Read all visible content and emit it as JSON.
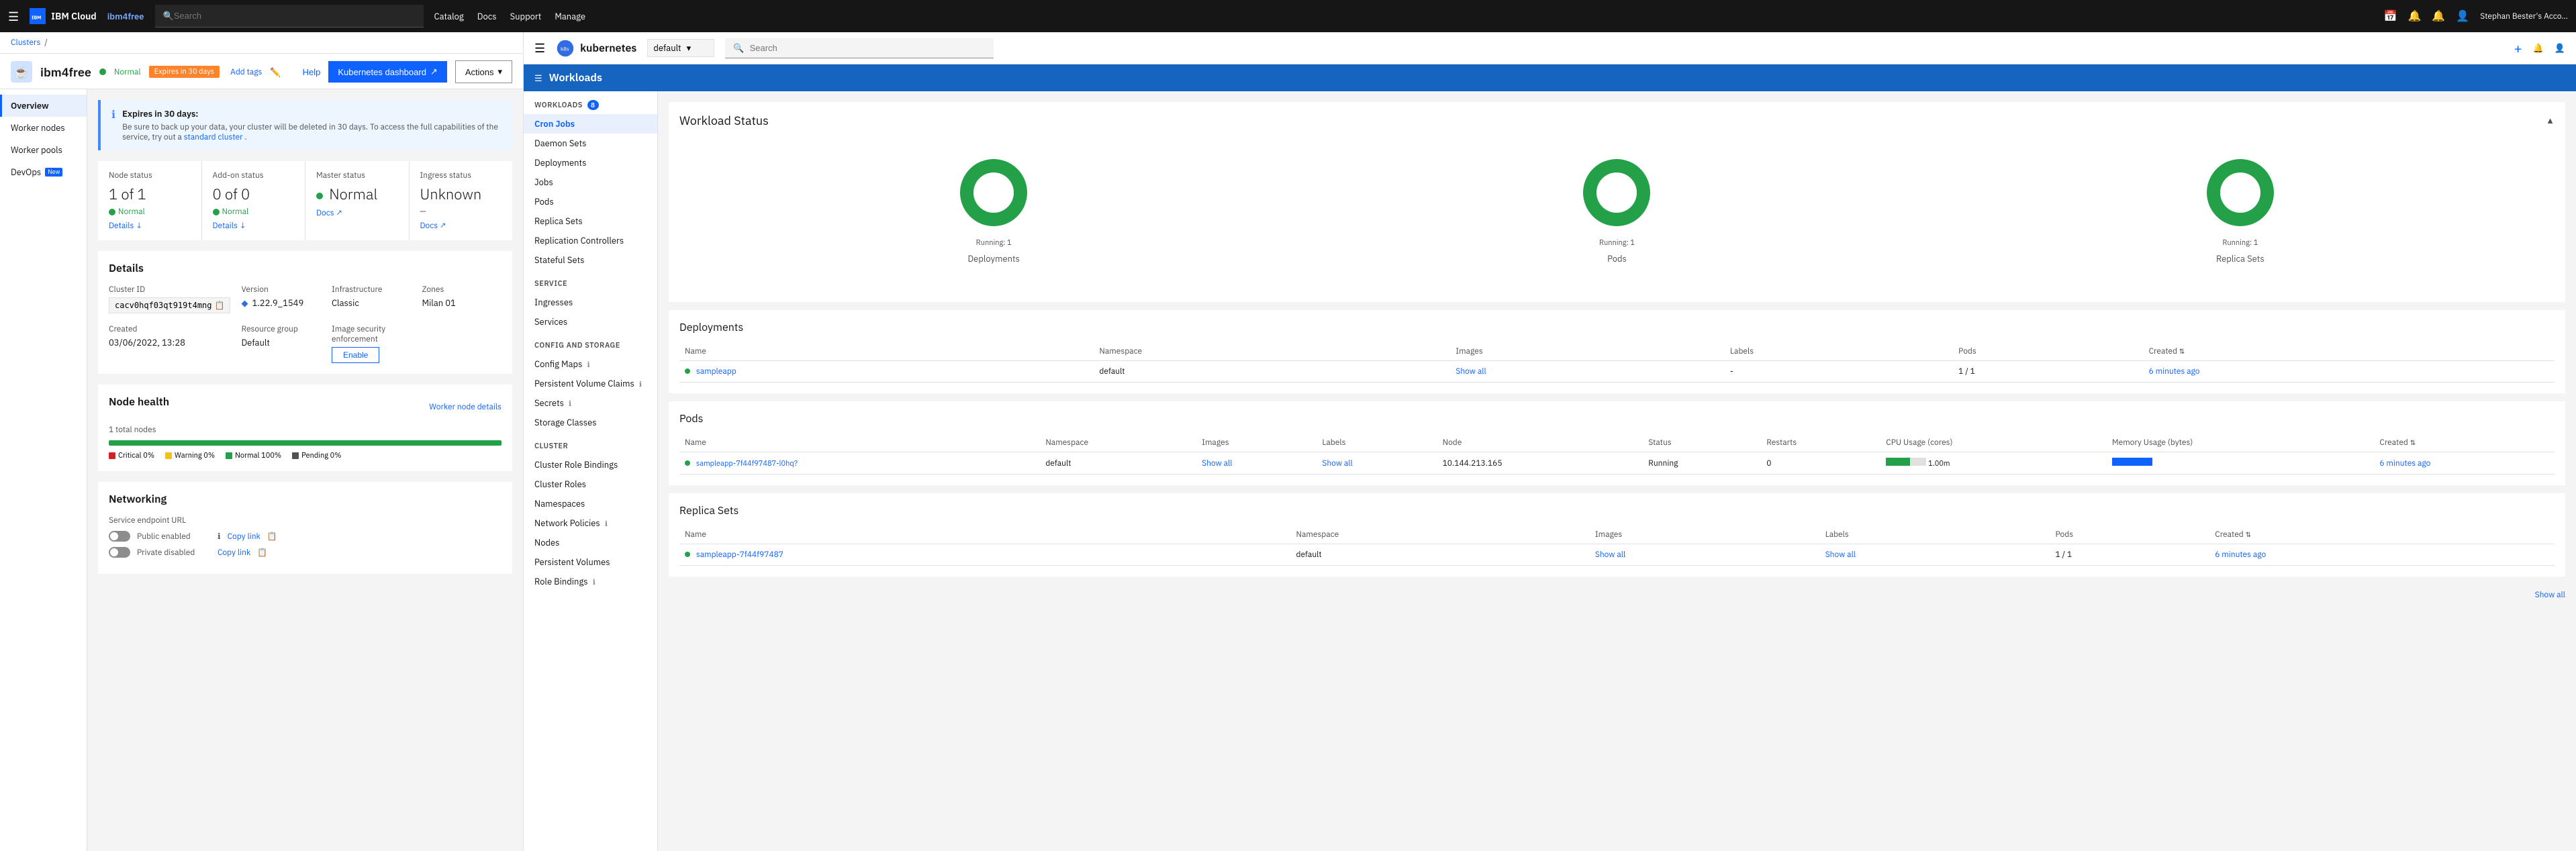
{
  "topnav": {
    "brand": "IBM Cloud",
    "appname": "ibm4free",
    "search_placeholder": "Search",
    "links": [
      "Catalog",
      "Docs",
      "Support"
    ],
    "manage": "Manage",
    "user": "Stephan Bester's Acco..."
  },
  "breadcrumb": {
    "parent": "Clusters",
    "current": "ibm4free"
  },
  "cluster": {
    "name": "ibm4free",
    "status": "Normal",
    "expires_badge": "Expires in 30 days",
    "add_tags": "Add tags",
    "help": "Help",
    "k8s_dashboard": "Kubernetes dashboard",
    "actions": "Actions"
  },
  "leftnav": {
    "items": [
      {
        "label": "Overview",
        "active": true
      },
      {
        "label": "Worker nodes",
        "active": false
      },
      {
        "label": "Worker pools",
        "active": false
      },
      {
        "label": "DevOps",
        "active": false,
        "badge": "New"
      }
    ]
  },
  "alert": {
    "title": "Expires in 30 days:",
    "body": "Be sure to back up your data, your cluster will be deleted in 30 days. To access the full capabilities of the service, try out a",
    "link_text": "standard cluster",
    "body_end": "."
  },
  "status_cards": [
    {
      "label": "Node status",
      "value": "1 of 1",
      "sub": "Normal",
      "link": "Details ↓"
    },
    {
      "label": "Add-on status",
      "value": "0 of 0",
      "sub": "Normal",
      "link": "Details ↓"
    },
    {
      "label": "Master status",
      "value": "Normal",
      "sub": "",
      "link": "Docs ↗"
    },
    {
      "label": "Ingress status",
      "value": "Unknown",
      "sub": "—",
      "link": "Docs ↗"
    }
  ],
  "details": {
    "title": "Details",
    "cluster_id_label": "Cluster ID",
    "cluster_id": "cacv0hqf03qt919t4mng",
    "version_label": "Version",
    "version": "1.22.9_1549",
    "infrastructure_label": "Infrastructure",
    "infrastructure": "Classic",
    "zones_label": "Zones",
    "zones": "Milan 01",
    "created_label": "Created",
    "created": "03/06/2022, 13:28",
    "resource_group_label": "Resource group",
    "resource_group": "Default",
    "image_security_label": "Image security enforcement",
    "image_security_btn": "Enable"
  },
  "node_health": {
    "title": "Node health",
    "link": "Worker node details",
    "total": "1 total nodes",
    "progress_green": 100,
    "legend": [
      {
        "color": "red",
        "label": "Critical 0%"
      },
      {
        "color": "yellow",
        "label": "Warning 0%"
      },
      {
        "color": "green",
        "label": "Normal 100%"
      },
      {
        "color": "gray",
        "label": "Pending 0%"
      }
    ]
  },
  "networking": {
    "title": "Networking",
    "service_endpoint_label": "Service endpoint URL",
    "rows": [
      {
        "toggle": false,
        "label": "Public enabled",
        "link": "Copy link",
        "info": true
      },
      {
        "toggle": false,
        "label": "Private disabled",
        "link": "Copy link",
        "info": false
      }
    ]
  },
  "k8s": {
    "logo": "kubernetes",
    "namespace_label": "default",
    "search_placeholder": "Search",
    "workloads_header": "Workloads",
    "sidebar": {
      "workloads_section": "Workloads",
      "workloads_badge": "8",
      "workloads_items": [
        "Cron Jobs",
        "Daemon Sets",
        "Deployments",
        "Jobs",
        "Pods",
        "Replica Sets",
        "Replication Controllers",
        "Stateful Sets"
      ],
      "service_section": "Service",
      "service_badge": "",
      "service_items": [
        "Ingresses",
        "Services"
      ],
      "config_section": "Config and Storage",
      "config_items": [
        "Config Maps",
        "Persistent Volume Claims",
        "Secrets",
        "Storage Classes"
      ],
      "cluster_section": "Cluster",
      "cluster_items": [
        "Cluster Role Bindings",
        "Cluster Roles",
        "Namespaces",
        "Network Policies",
        "Nodes",
        "Persistent Volumes",
        "Role Bindings"
      ]
    },
    "workload_status": {
      "title": "Workload Status",
      "charts": [
        {
          "label": "Deployments",
          "sub": "Running: 1",
          "count": 1
        },
        {
          "label": "Pods",
          "sub": "Running: 1",
          "count": 1
        },
        {
          "label": "Replica Sets",
          "sub": "Running: 1",
          "count": 1
        }
      ]
    },
    "deployments": {
      "title": "Deployments",
      "columns": [
        "Name",
        "Namespace",
        "Images",
        "Labels",
        "Pods",
        "Created"
      ],
      "rows": [
        {
          "status": "green",
          "name": "sampleapp",
          "namespace": "default",
          "images": "Show all",
          "labels": "-",
          "pods": "1 / 1",
          "created": "6 minutes ago"
        }
      ]
    },
    "pods": {
      "title": "Pods",
      "columns": [
        "Name",
        "Namespace",
        "Images",
        "Labels",
        "Node",
        "Status",
        "Restarts",
        "CPU Usage (cores)",
        "Memory Usage (bytes)",
        "Created"
      ],
      "rows": [
        {
          "status": "green",
          "name": "sampleapp-7f44f97487-l0hq?",
          "namespace": "default",
          "images": "Show all",
          "labels": "Show all",
          "node": "10.144.213.165",
          "pod_status": "Running",
          "restarts": "0",
          "cpu": "1.00m",
          "memory": "...",
          "created": "6 minutes ago"
        }
      ]
    },
    "replica_sets": {
      "title": "Replica Sets",
      "columns": [
        "Name",
        "Namespace",
        "Images",
        "Labels",
        "Pods",
        "Created"
      ],
      "rows": [
        {
          "status": "green",
          "name": "sampleapp-7f44f97487",
          "namespace": "default",
          "images": "Show all",
          "labels": "Show all",
          "pods": "1 / 1",
          "created": "6 minutes ago"
        }
      ]
    },
    "show_all": "Show all",
    "services_label": "Services"
  }
}
